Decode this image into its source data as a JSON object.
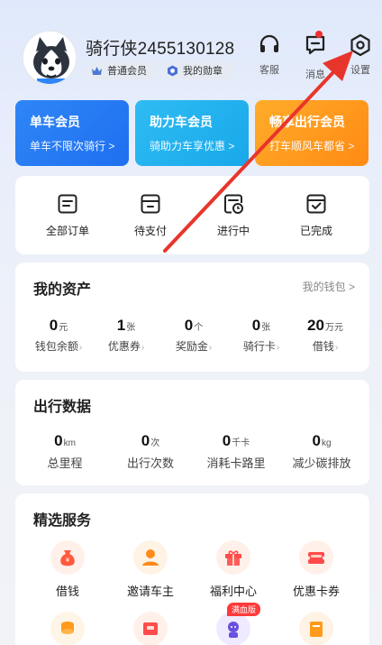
{
  "header": {
    "username": "骑行侠2455130128",
    "member_badge": "普通会员",
    "medal_badge": "我的勋章",
    "service_label": "客服",
    "message_label": "消息",
    "settings_label": "设置"
  },
  "member_cards": [
    {
      "title": "单车会员",
      "subtitle": "单车不限次骑行 >"
    },
    {
      "title": "助力车会员",
      "subtitle": "骑助力车享优惠 >"
    },
    {
      "title": "畅享出行会员",
      "subtitle": "打车顺风车都省 >"
    }
  ],
  "orders": [
    {
      "label": "全部订单",
      "icon": "order-list-icon"
    },
    {
      "label": "待支付",
      "icon": "wallet-icon"
    },
    {
      "label": "进行中",
      "icon": "in-progress-icon"
    },
    {
      "label": "已完成",
      "icon": "completed-icon"
    }
  ],
  "assets": {
    "title": "我的资产",
    "wallet_link": "我的钱包 >",
    "items": [
      {
        "value": "0",
        "unit": "元",
        "label": "钱包余额"
      },
      {
        "value": "1",
        "unit": "张",
        "label": "优惠券"
      },
      {
        "value": "0",
        "unit": "个",
        "label": "奖励金"
      },
      {
        "value": "0",
        "unit": "张",
        "label": "骑行卡"
      },
      {
        "value": "20",
        "unit": "万元",
        "label": "借钱"
      }
    ]
  },
  "travel": {
    "title": "出行数据",
    "items": [
      {
        "value": "0",
        "unit": "km",
        "label": "总里程"
      },
      {
        "value": "0",
        "unit": "次",
        "label": "出行次数"
      },
      {
        "value": "0",
        "unit": "千卡",
        "label": "消耗卡路里"
      },
      {
        "value": "0",
        "unit": "kg",
        "label": "减少碳排放"
      }
    ]
  },
  "services": {
    "title": "精选服务",
    "items": [
      {
        "label": "借钱",
        "icon": "money-bag-icon"
      },
      {
        "label": "邀请车主",
        "icon": "driver-icon"
      },
      {
        "label": "福利中心",
        "icon": "gift-icon"
      },
      {
        "label": "优惠卡券",
        "icon": "coupon-icon"
      }
    ],
    "row2_tag": "满血版"
  },
  "colors": {
    "accent_blue": "#1f6ff0",
    "assist_blue": "#18a8ea",
    "orange": "#ff8a14",
    "annotation_red": "#e8352c"
  }
}
